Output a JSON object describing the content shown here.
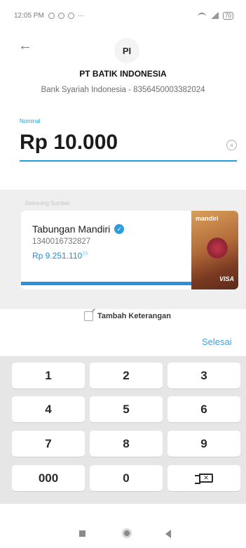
{
  "status_bar": {
    "time": "12:05 PM",
    "extra": "···",
    "battery": "70"
  },
  "header": {
    "back_icon": "←",
    "avatar_initials": "PI",
    "recipient_name": "PT BATIK INDONESIA",
    "recipient_bank": "Bank Syariah Indonesia - 8356450003382024"
  },
  "amount": {
    "label": "Nominal",
    "value": "Rp 10.000",
    "clear_icon": "×"
  },
  "source": {
    "label": "Rekening Sumber",
    "account_name": "Tabungan Mandiri",
    "verified_icon": "✓",
    "account_number": "1340016732827",
    "balance": "Rp 9.251.110",
    "balance_cents": "20",
    "card_brand": "mandiri",
    "card_network": "VISA"
  },
  "note": {
    "label": "Tambah Keterangan"
  },
  "keypad": {
    "done_label": "Selesai",
    "keys": [
      "1",
      "2",
      "3",
      "4",
      "5",
      "6",
      "7",
      "8",
      "9",
      "000",
      "0"
    ]
  },
  "colors": {
    "accent": "#1da1d8",
    "balance": "#1f8fd6",
    "keypad_bg": "#e6e6e6"
  }
}
